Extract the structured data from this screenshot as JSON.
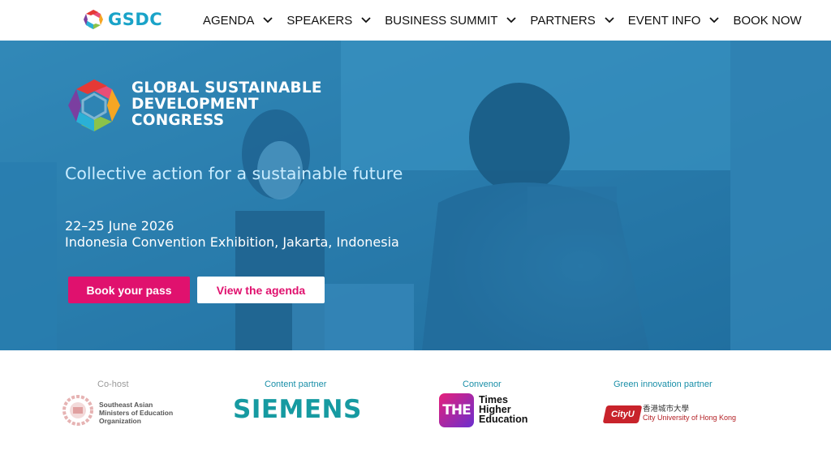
{
  "header": {
    "logo_text": "GSDC",
    "nav": [
      {
        "label": "AGENDA",
        "has_dropdown": true
      },
      {
        "label": "SPEAKERS",
        "has_dropdown": true
      },
      {
        "label": "BUSINESS SUMMIT",
        "has_dropdown": true
      },
      {
        "label": "PARTNERS",
        "has_dropdown": true
      },
      {
        "label": "EVENT INFO",
        "has_dropdown": true
      },
      {
        "label": "BOOK NOW",
        "has_dropdown": false
      }
    ]
  },
  "hero": {
    "title_lines": [
      "GLOBAL SUSTAINABLE",
      "DEVELOPMENT",
      "CONGRESS"
    ],
    "tagline": "Collective action for a sustainable future",
    "date": "22–25 June 2026",
    "venue": "Indonesia Convention Exhibition, Jakarta, Indonesia",
    "primary_cta": "Book your pass",
    "secondary_cta": "View the agenda"
  },
  "partners": [
    {
      "role": "Co-host",
      "name_lines": [
        "Southeast Asian",
        "Ministers of Education",
        "Organization"
      ]
    },
    {
      "role": "Content partner",
      "name": "SIEMENS"
    },
    {
      "role": "Convenor",
      "badge": "THE",
      "name_lines": [
        "Times",
        "Higher",
        "Education"
      ]
    },
    {
      "role": "Green innovation partner",
      "badge": "CityU",
      "name_lines": [
        "香港城市大學",
        "City University of Hong Kong"
      ]
    }
  ],
  "colors": {
    "brand_blue": "#1aa3c8",
    "cta_pink": "#e0116e",
    "hero_overlay": "#2180b9",
    "siemens_teal": "#169aa1",
    "cityu_red": "#b31f24"
  }
}
